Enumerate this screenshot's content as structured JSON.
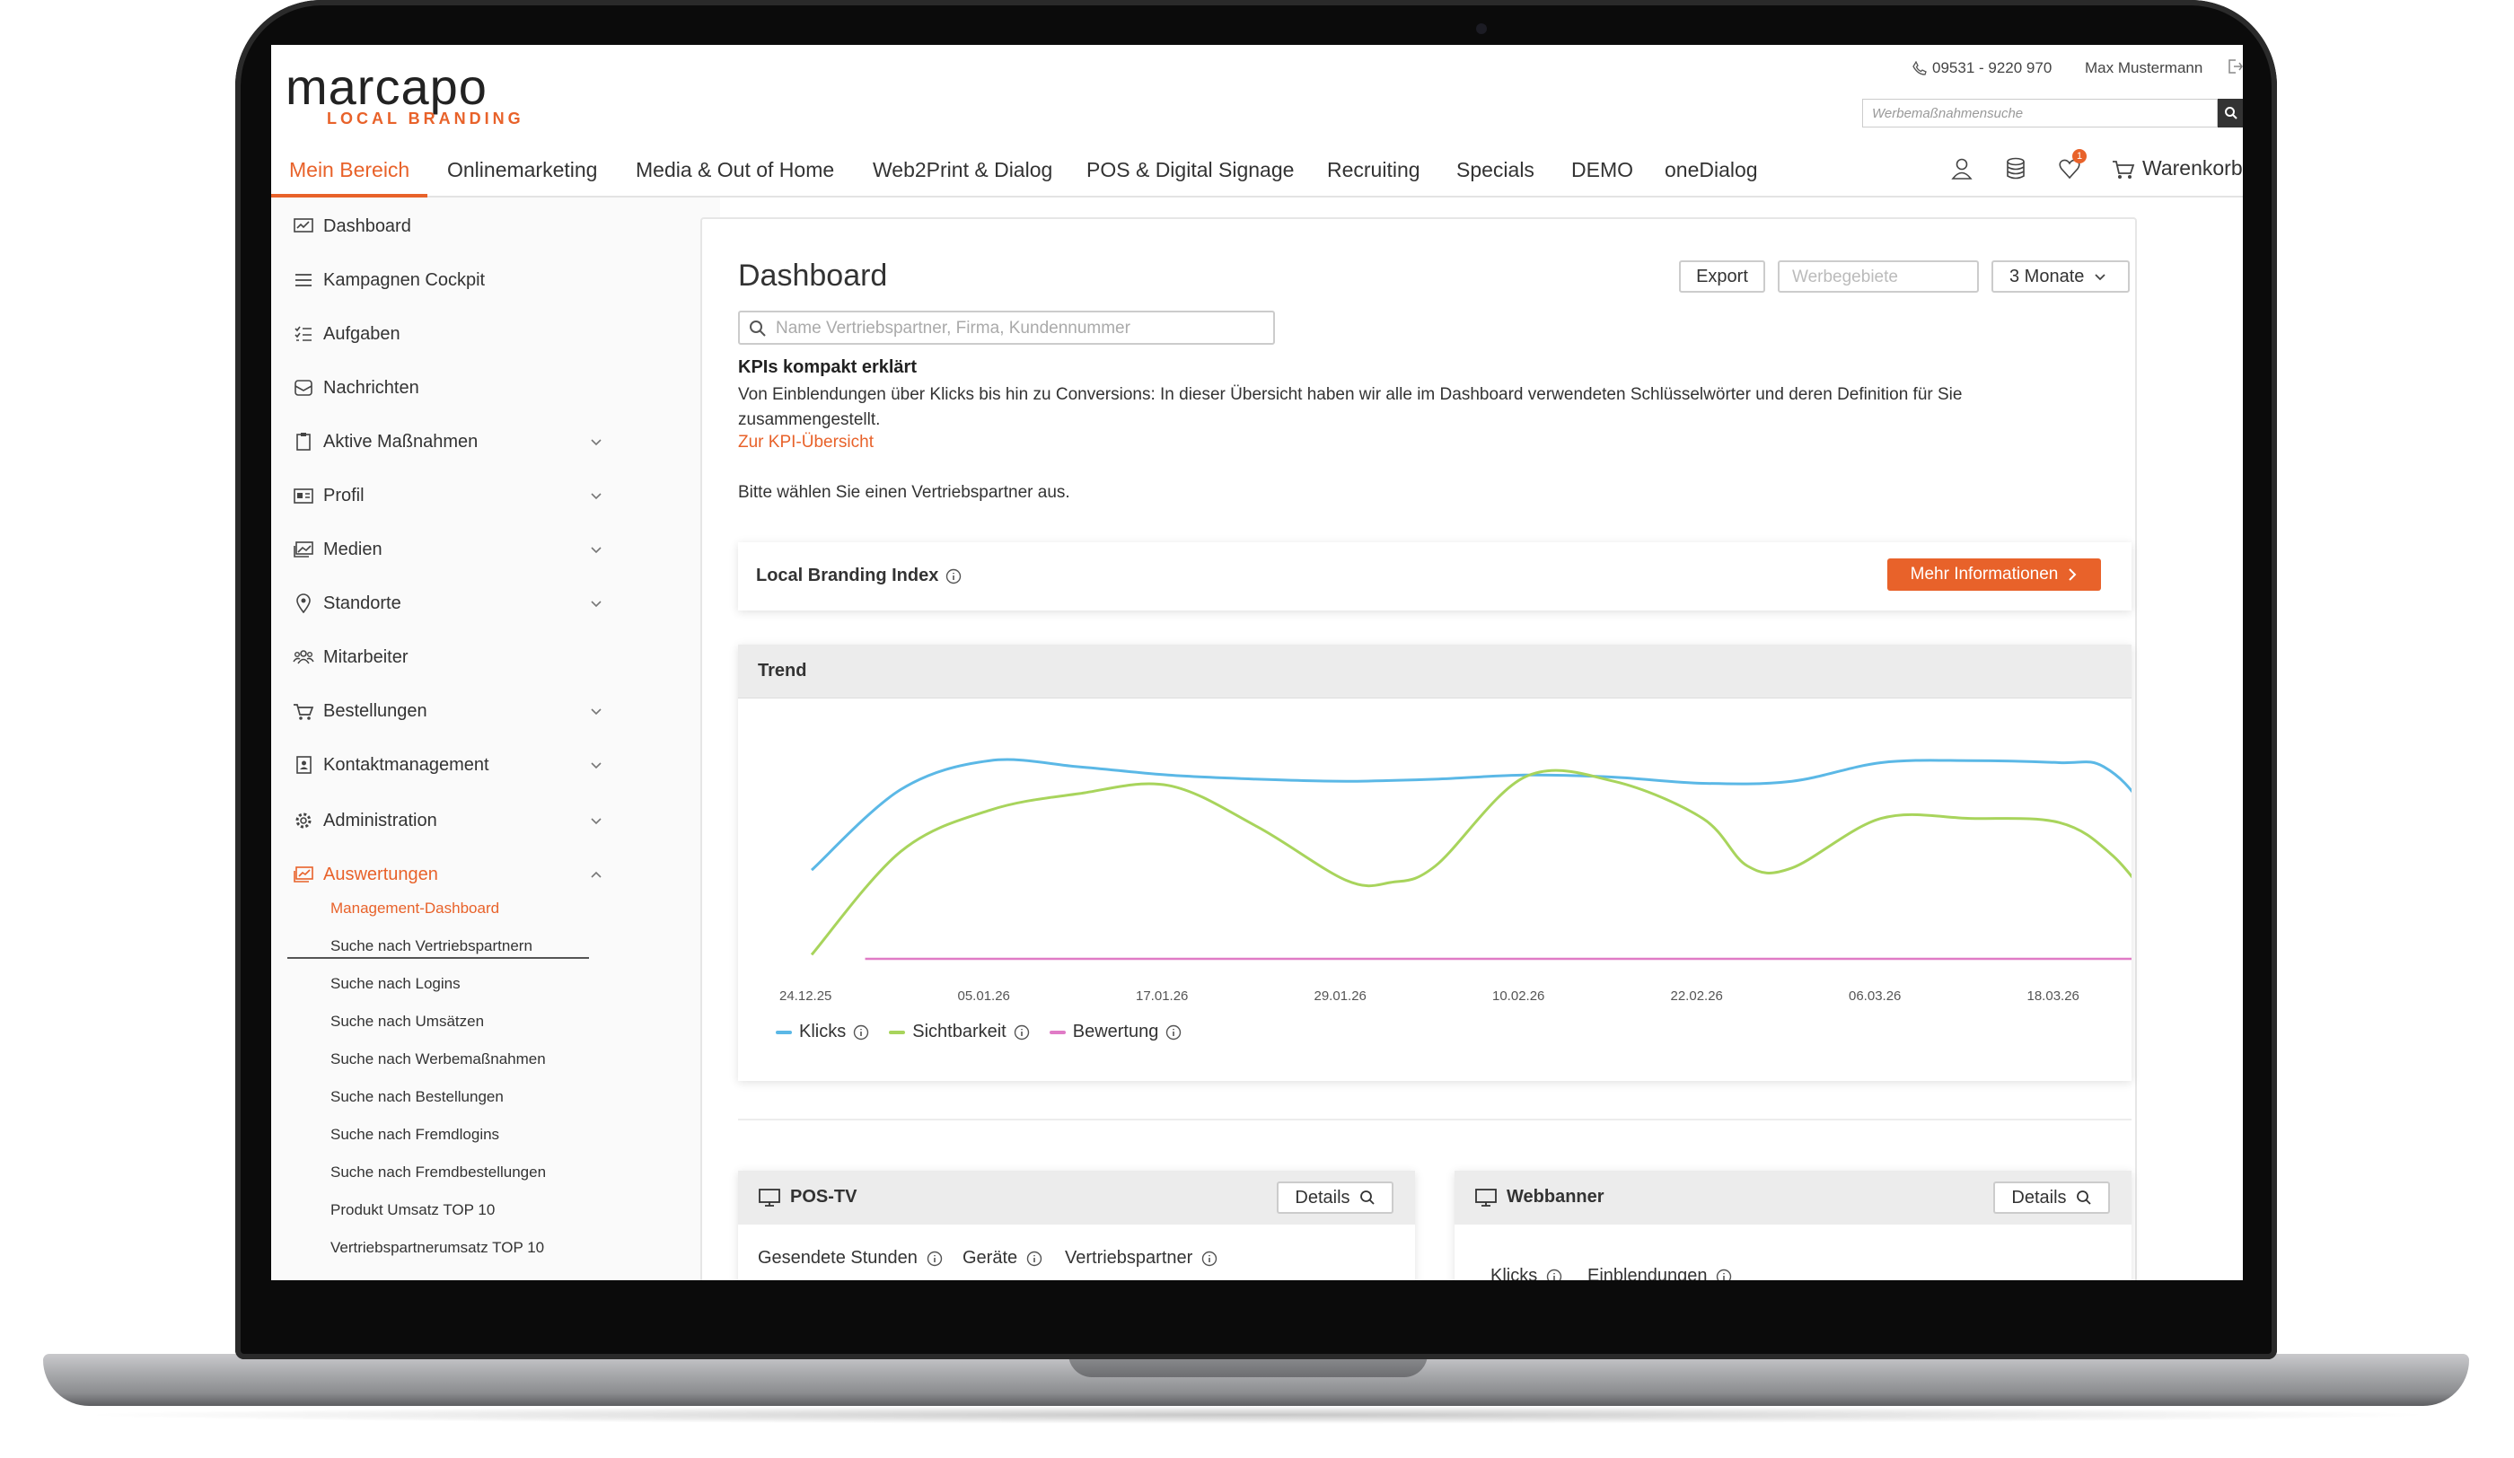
{
  "brand": {
    "name": "marcapo",
    "tagline": "LOCAL BRANDING",
    "accent": "#e8622a"
  },
  "topbar": {
    "phone": "09531 - 9220 970",
    "user": "Max Mustermann",
    "search_placeholder": "Werbemaßnahmensuche"
  },
  "nav": {
    "items": [
      "Mein Bereich",
      "Onlinemarketing",
      "Media & Out of Home",
      "Web2Print & Dialog",
      "POS & Digital Signage",
      "Recruiting",
      "Specials",
      "DEMO",
      "oneDialog"
    ],
    "active": "Mein Bereich",
    "cart_label": "Warenkorb",
    "wishlist_count": "1"
  },
  "sidebar": {
    "items": [
      "Dashboard",
      "Kampagnen Cockpit",
      "Aufgaben",
      "Nachrichten",
      "Aktive Maßnahmen",
      "Profil",
      "Medien",
      "Standorte",
      "Mitarbeiter",
      "Bestellungen",
      "Kontaktmanagement",
      "Administration",
      "Auswertungen"
    ],
    "active": "Auswertungen",
    "subitems": [
      "Management-Dashboard",
      "Suche nach Vertriebspartnern",
      "Suche nach Logins",
      "Suche nach Umsätzen",
      "Suche nach Werbemaßnahmen",
      "Suche nach Bestellungen",
      "Suche nach Fremdlogins",
      "Suche nach Fremdbestellungen",
      "Produkt Umsatz TOP 10",
      "Vertriebspartnerumsatz TOP 10"
    ],
    "active_subitem": "Management-Dashboard"
  },
  "dashboard": {
    "title": "Dashboard",
    "export_label": "Export",
    "regions_placeholder": "Werbegebiete",
    "period_label": "3 Monate",
    "search_placeholder": "Name Vertriebspartner, Firma, Kundennummer",
    "kpi_heading": "KPIs kompakt erklärt",
    "kpi_text": "Von Einblendungen über Klicks bis hin zu Conversions: In dieser Übersicht haben wir alle im Dashboard verwendeten Schlüsselwörter und deren Definition für Sie zusammengestellt.",
    "kpi_link": "Zur KPI-Übersicht",
    "choose_partner": "Bitte wählen Sie einen Vertriebspartner aus.",
    "lbi_label": "Local Branding Index",
    "more_info_label": "Mehr Informationen",
    "trend_title": "Trend",
    "pos_title": "POS-TV",
    "pos_metrics": [
      "Gesendete Stunden",
      "Geräte",
      "Vertriebspartner"
    ],
    "banner_title": "Webbanner",
    "banner_metrics": [
      "Klicks",
      "Einblendungen"
    ],
    "details_label": "Details"
  },
  "chart_data": {
    "type": "line",
    "title": "Trend",
    "x": [
      "24.12.25",
      "05.01.26",
      "17.01.26",
      "29.01.26",
      "10.02.26",
      "22.02.26",
      "06.03.26",
      "18.03.26"
    ],
    "xlabel": "",
    "ylabel": "",
    "y_axis_shown": false,
    "grid": false,
    "legend_position": "bottom-left",
    "series": [
      {
        "name": "Klicks",
        "color": "#5bb8e6",
        "points": [
          [
            0,
            0.43
          ],
          [
            0.5,
            0.82
          ],
          [
            1,
            0.96
          ],
          [
            1.5,
            0.93
          ],
          [
            2,
            0.89
          ],
          [
            2.5,
            0.87
          ],
          [
            3,
            0.86
          ],
          [
            3.5,
            0.87
          ],
          [
            4,
            0.89
          ],
          [
            4.5,
            0.88
          ],
          [
            5,
            0.85
          ],
          [
            5.5,
            0.86
          ],
          [
            6,
            0.95
          ],
          [
            6.5,
            0.96
          ],
          [
            7,
            0.95
          ],
          [
            7.25,
            0.93
          ],
          [
            7.5,
            0.7
          ],
          [
            7.85,
            0.12
          ]
        ]
      },
      {
        "name": "Sichtbarkeit",
        "color": "#a8d45c",
        "points": [
          [
            0,
            0.02
          ],
          [
            0.5,
            0.52
          ],
          [
            1,
            0.72
          ],
          [
            1.5,
            0.8
          ],
          [
            2,
            0.84
          ],
          [
            2.5,
            0.64
          ],
          [
            3,
            0.38
          ],
          [
            3.25,
            0.37
          ],
          [
            3.5,
            0.45
          ],
          [
            4,
            0.88
          ],
          [
            4.5,
            0.86
          ],
          [
            5,
            0.68
          ],
          [
            5.25,
            0.45
          ],
          [
            5.5,
            0.44
          ],
          [
            6,
            0.68
          ],
          [
            6.5,
            0.68
          ],
          [
            7,
            0.66
          ],
          [
            7.3,
            0.5
          ],
          [
            7.6,
            0.2
          ],
          [
            7.85,
            0.07
          ]
        ]
      },
      {
        "name": "Bewertung",
        "color": "#e07bc6",
        "points": [
          [
            0.3,
            0
          ],
          [
            7.85,
            0
          ]
        ]
      }
    ]
  }
}
